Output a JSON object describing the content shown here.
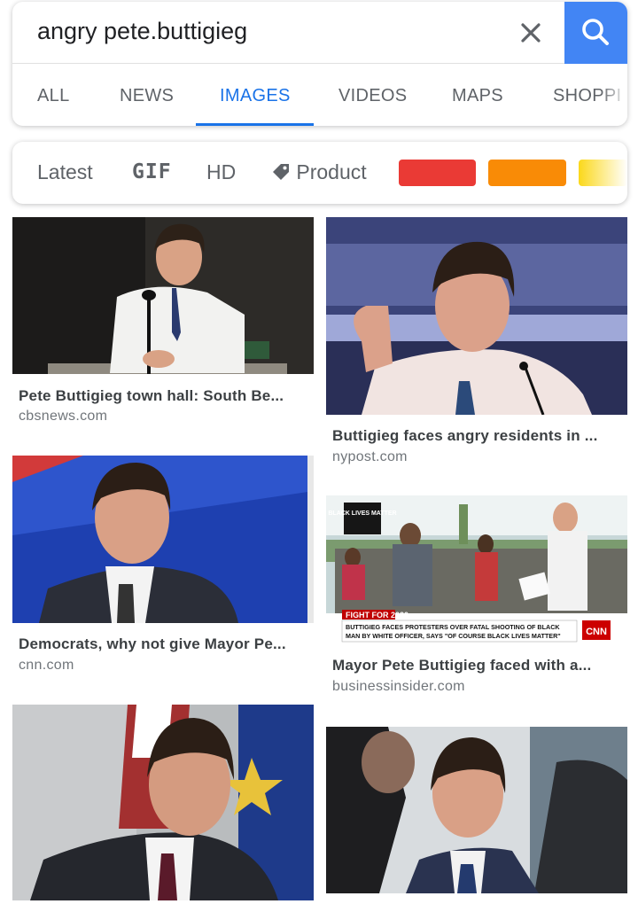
{
  "search": {
    "query": "angry pete.buttigieg"
  },
  "tabs": [
    {
      "label": "ALL"
    },
    {
      "label": "NEWS"
    },
    {
      "label": "IMAGES",
      "active": true
    },
    {
      "label": "VIDEOS"
    },
    {
      "label": "MAPS"
    },
    {
      "label": "SHOPPI"
    }
  ],
  "filters": {
    "latest": "Latest",
    "gif": "GIF",
    "hd": "HD",
    "product": "Product",
    "color_chips": [
      "#ea3a35",
      "#f98b06",
      "#fbd81a"
    ]
  },
  "results": [
    {
      "title": "Pete Buttigieg town hall: South Be...",
      "source": "cbsnews.com"
    },
    {
      "title": "Buttigieg faces angry residents in ...",
      "source": "nypost.com"
    },
    {
      "title": "Democrats, why not give Mayor Pe...",
      "source": "cnn.com"
    },
    {
      "title": "Mayor Pete Buttigieg faced with a...",
      "source": "businessinsider.com"
    },
    {
      "title": "",
      "source": ""
    },
    {
      "title": "",
      "source": ""
    }
  ],
  "image_overlays": {
    "sign": "BLACK LIVES MATTER",
    "banner_title": "FIGHT FOR 2020",
    "banner_line1": "BUTTIGIEG FACES PROTESTERS OVER FATAL SHOOTING OF BLACK",
    "banner_line2": "MAN BY WHITE OFFICER, SAYS \"OF COURSE BLACK LIVES MATTER\"",
    "network": "CNN"
  },
  "colors": {
    "accent": "#1a73e8",
    "search_button": "#4285f4"
  }
}
